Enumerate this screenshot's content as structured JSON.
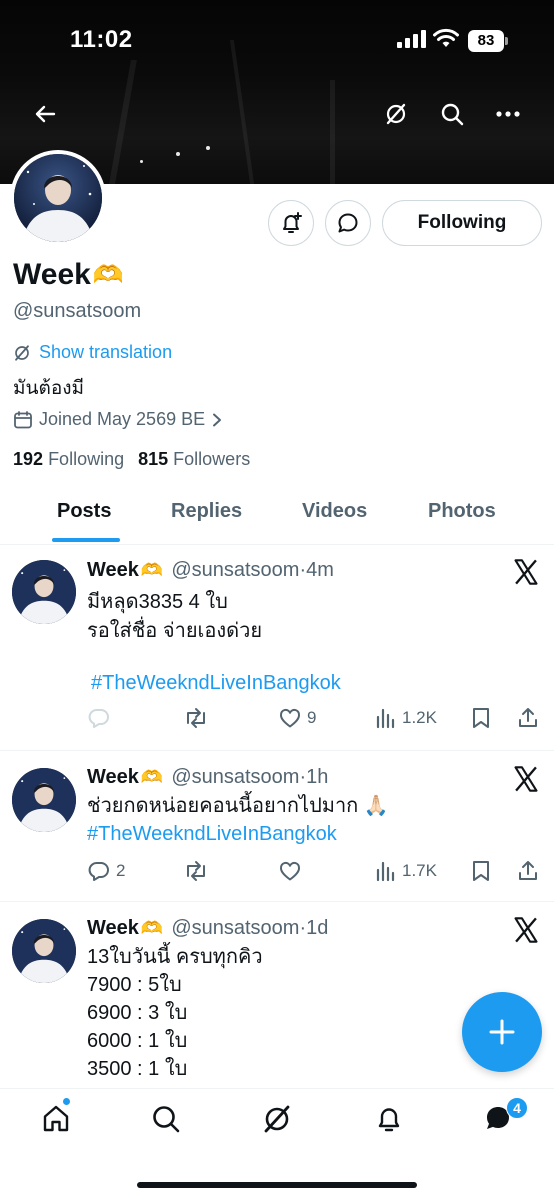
{
  "status_bar": {
    "time": "11:02",
    "battery": "83"
  },
  "profile": {
    "display_name": "Week",
    "emoji": "🫶",
    "handle": "@sunsatsoom",
    "translate_label": "Show translation",
    "bio": "มันต้องมี",
    "joined": "Joined May 2569 BE",
    "following_count": "192",
    "following_label": "Following",
    "followers_count": "815",
    "followers_label": "Followers",
    "follow_button": "Following"
  },
  "tabs": [
    "Posts",
    "Replies",
    "Videos",
    "Photos"
  ],
  "posts": [
    {
      "name": "Week",
      "emoji": "🫶",
      "handle": "@sunsatsoom",
      "time": "·4m",
      "text": "มีหลุด3835 4 ใบ\nรอใส่ชื่อ จ่ายเองด่วย",
      "hashtag": "#TheWeekndLiveInBangkok",
      "replies": "",
      "reposts": "",
      "likes": "9",
      "views": "1.2K"
    },
    {
      "name": "Week",
      "emoji": "🫶",
      "handle": "@sunsatsoom",
      "time": "·1h",
      "text": "ช่วยกดหน่อยคอนนี้อยากไปมาก 🙏🏻",
      "hashtag": "#TheWeekndLiveInBangkok",
      "replies": "2",
      "reposts": "",
      "likes": "",
      "views": "1.7K"
    },
    {
      "name": "Week",
      "emoji": "🫶",
      "handle": "@sunsatsoom",
      "time": "·1d",
      "text": "13ใบวันนี้ ครบทุกคิว\n7900 : 5ใบ\n6900 : 3 ใบ\n6000 : 1 ใบ\n3500 : 1 ใบ"
    }
  ],
  "bottom_nav": {
    "messages_badge": "4"
  },
  "colors": {
    "accent": "#1d9bf0",
    "text": "#0f1419",
    "muted": "#536471"
  },
  "icons": [
    "back-arrow-icon",
    "grok-icon",
    "search-icon",
    "more-icon",
    "notification-plus-icon",
    "message-icon",
    "translate-icon",
    "calendar-icon",
    "chevron-right-icon",
    "x-logo-icon",
    "reply-icon",
    "repost-icon",
    "like-icon",
    "views-icon",
    "bookmark-icon",
    "share-icon",
    "plus-icon",
    "home-icon",
    "bell-icon",
    "messages-icon"
  ]
}
